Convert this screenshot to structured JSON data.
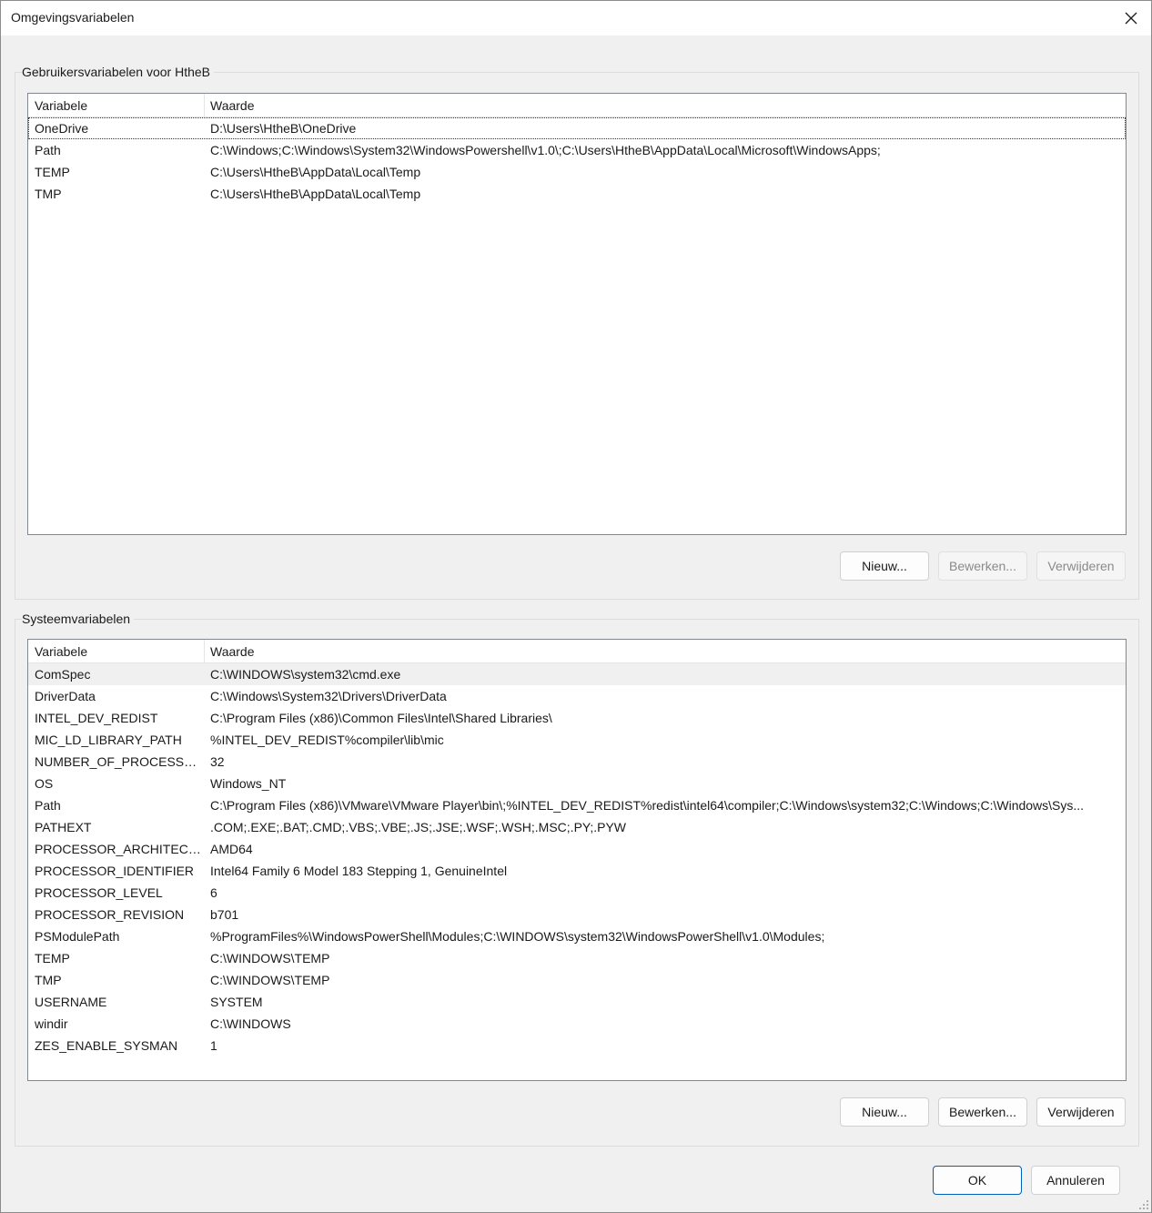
{
  "window": {
    "title": "Omgevingsvariabelen",
    "close_icon": "close-icon"
  },
  "user_vars": {
    "group_label": "Gebruikersvariabelen voor HtheB",
    "columns": [
      "Variabele",
      "Waarde"
    ],
    "rows": [
      {
        "name": "OneDrive",
        "value": "D:\\Users\\HtheB\\OneDrive"
      },
      {
        "name": "Path",
        "value": "C:\\Windows;C:\\Windows\\System32\\WindowsPowershell\\v1.0\\;C:\\Users\\HtheB\\AppData\\Local\\Microsoft\\WindowsApps;"
      },
      {
        "name": "TEMP",
        "value": "C:\\Users\\HtheB\\AppData\\Local\\Temp"
      },
      {
        "name": "TMP",
        "value": "C:\\Users\\HtheB\\AppData\\Local\\Temp"
      }
    ],
    "buttons": {
      "new": "Nieuw...",
      "edit": "Bewerken...",
      "delete": "Verwijderen"
    }
  },
  "system_vars": {
    "group_label": "Systeemvariabelen",
    "columns": [
      "Variabele",
      "Waarde"
    ],
    "rows": [
      {
        "name": "ComSpec",
        "value": "C:\\WINDOWS\\system32\\cmd.exe"
      },
      {
        "name": "DriverData",
        "value": "C:\\Windows\\System32\\Drivers\\DriverData"
      },
      {
        "name": "INTEL_DEV_REDIST",
        "value": "C:\\Program Files (x86)\\Common Files\\Intel\\Shared Libraries\\"
      },
      {
        "name": "MIC_LD_LIBRARY_PATH",
        "value": "%INTEL_DEV_REDIST%compiler\\lib\\mic"
      },
      {
        "name": "NUMBER_OF_PROCESSORS",
        "value": "32"
      },
      {
        "name": "OS",
        "value": "Windows_NT"
      },
      {
        "name": "Path",
        "value": "C:\\Program Files (x86)\\VMware\\VMware Player\\bin\\;%INTEL_DEV_REDIST%redist\\intel64\\compiler;C:\\Windows\\system32;C:\\Windows;C:\\Windows\\Sys..."
      },
      {
        "name": "PATHEXT",
        "value": ".COM;.EXE;.BAT;.CMD;.VBS;.VBE;.JS;.JSE;.WSF;.WSH;.MSC;.PY;.PYW"
      },
      {
        "name": "PROCESSOR_ARCHITECTU...",
        "value": "AMD64"
      },
      {
        "name": "PROCESSOR_IDENTIFIER",
        "value": "Intel64 Family 6 Model 183 Stepping 1, GenuineIntel"
      },
      {
        "name": "PROCESSOR_LEVEL",
        "value": "6"
      },
      {
        "name": "PROCESSOR_REVISION",
        "value": "b701"
      },
      {
        "name": "PSModulePath",
        "value": "%ProgramFiles%\\WindowsPowerShell\\Modules;C:\\WINDOWS\\system32\\WindowsPowerShell\\v1.0\\Modules;"
      },
      {
        "name": "TEMP",
        "value": "C:\\WINDOWS\\TEMP"
      },
      {
        "name": "TMP",
        "value": "C:\\WINDOWS\\TEMP"
      },
      {
        "name": "USERNAME",
        "value": "SYSTEM"
      },
      {
        "name": "windir",
        "value": "C:\\WINDOWS"
      },
      {
        "name": "ZES_ENABLE_SYSMAN",
        "value": "1"
      }
    ],
    "buttons": {
      "new": "Nieuw...",
      "edit": "Bewerken...",
      "delete": "Verwijderen"
    }
  },
  "footer": {
    "ok": "OK",
    "cancel": "Annuleren"
  },
  "colors": {
    "accent": "#005fb8",
    "window_bg": "#f0f0f0",
    "list_bg": "#ffffff"
  }
}
